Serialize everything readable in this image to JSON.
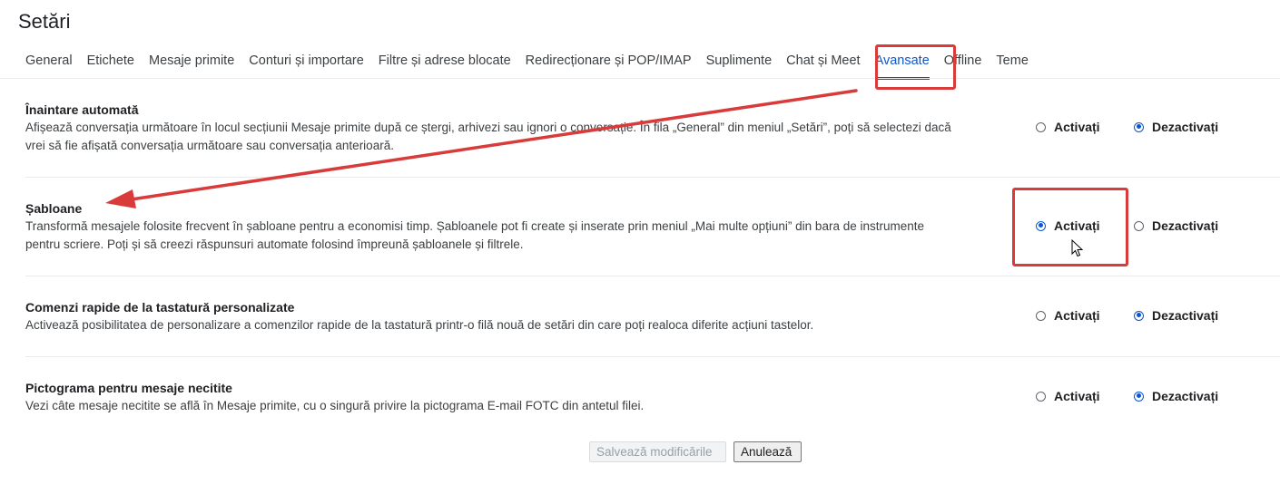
{
  "page": {
    "title": "Setări"
  },
  "tabs": [
    {
      "label": "General",
      "active": false
    },
    {
      "label": "Etichete",
      "active": false
    },
    {
      "label": "Mesaje primite",
      "active": false
    },
    {
      "label": "Conturi și importare",
      "active": false
    },
    {
      "label": "Filtre și adrese blocate",
      "active": false
    },
    {
      "label": "Redirecționare și POP/IMAP",
      "active": false
    },
    {
      "label": "Suplimente",
      "active": false
    },
    {
      "label": "Chat și Meet",
      "active": false
    },
    {
      "label": "Avansate",
      "active": true
    },
    {
      "label": "Offline",
      "active": false
    },
    {
      "label": "Teme",
      "active": false
    }
  ],
  "radio_labels": {
    "on": "Activați",
    "off": "Dezactivați"
  },
  "sections": [
    {
      "title": "Înaintare automată",
      "description": "Afișează conversația următoare în locul secțiunii Mesaje primite după ce ștergi, arhivezi sau ignori o conversație. În fila „General” din meniul „Setări”, poți să selectezi dacă vrei să fie afișată conversația următoare sau conversația anterioară.",
      "selected": "off"
    },
    {
      "title": "Șabloane",
      "description": "Transformă mesajele folosite frecvent în șabloane pentru a economisi timp. Șabloanele pot fi create și inserate prin meniul „Mai multe opțiuni” din bara de instrumente pentru scriere. Poți și să creezi răspunsuri automate folosind împreună șabloanele și filtrele.",
      "selected": "on"
    },
    {
      "title": "Comenzi rapide de la tastatură personalizate",
      "description": "Activează posibilitatea de personalizare a comenzilor rapide de la tastatură printr-o filă nouă de setări din care poți realoca diferite acțiuni tastelor.",
      "selected": "off"
    },
    {
      "title": "Pictograma pentru mesaje necitite",
      "description": "Vezi câte mesaje necitite se află în Mesaje primite, cu o singură privire la pictograma E-mail FOTC din antetul filei.",
      "selected": "off"
    }
  ],
  "buttons": {
    "save": "Salvează modificările",
    "cancel": "Anulează"
  },
  "annotation": {
    "color": "#d93a3a"
  },
  "colors": {
    "accent": "#0b57d0"
  }
}
